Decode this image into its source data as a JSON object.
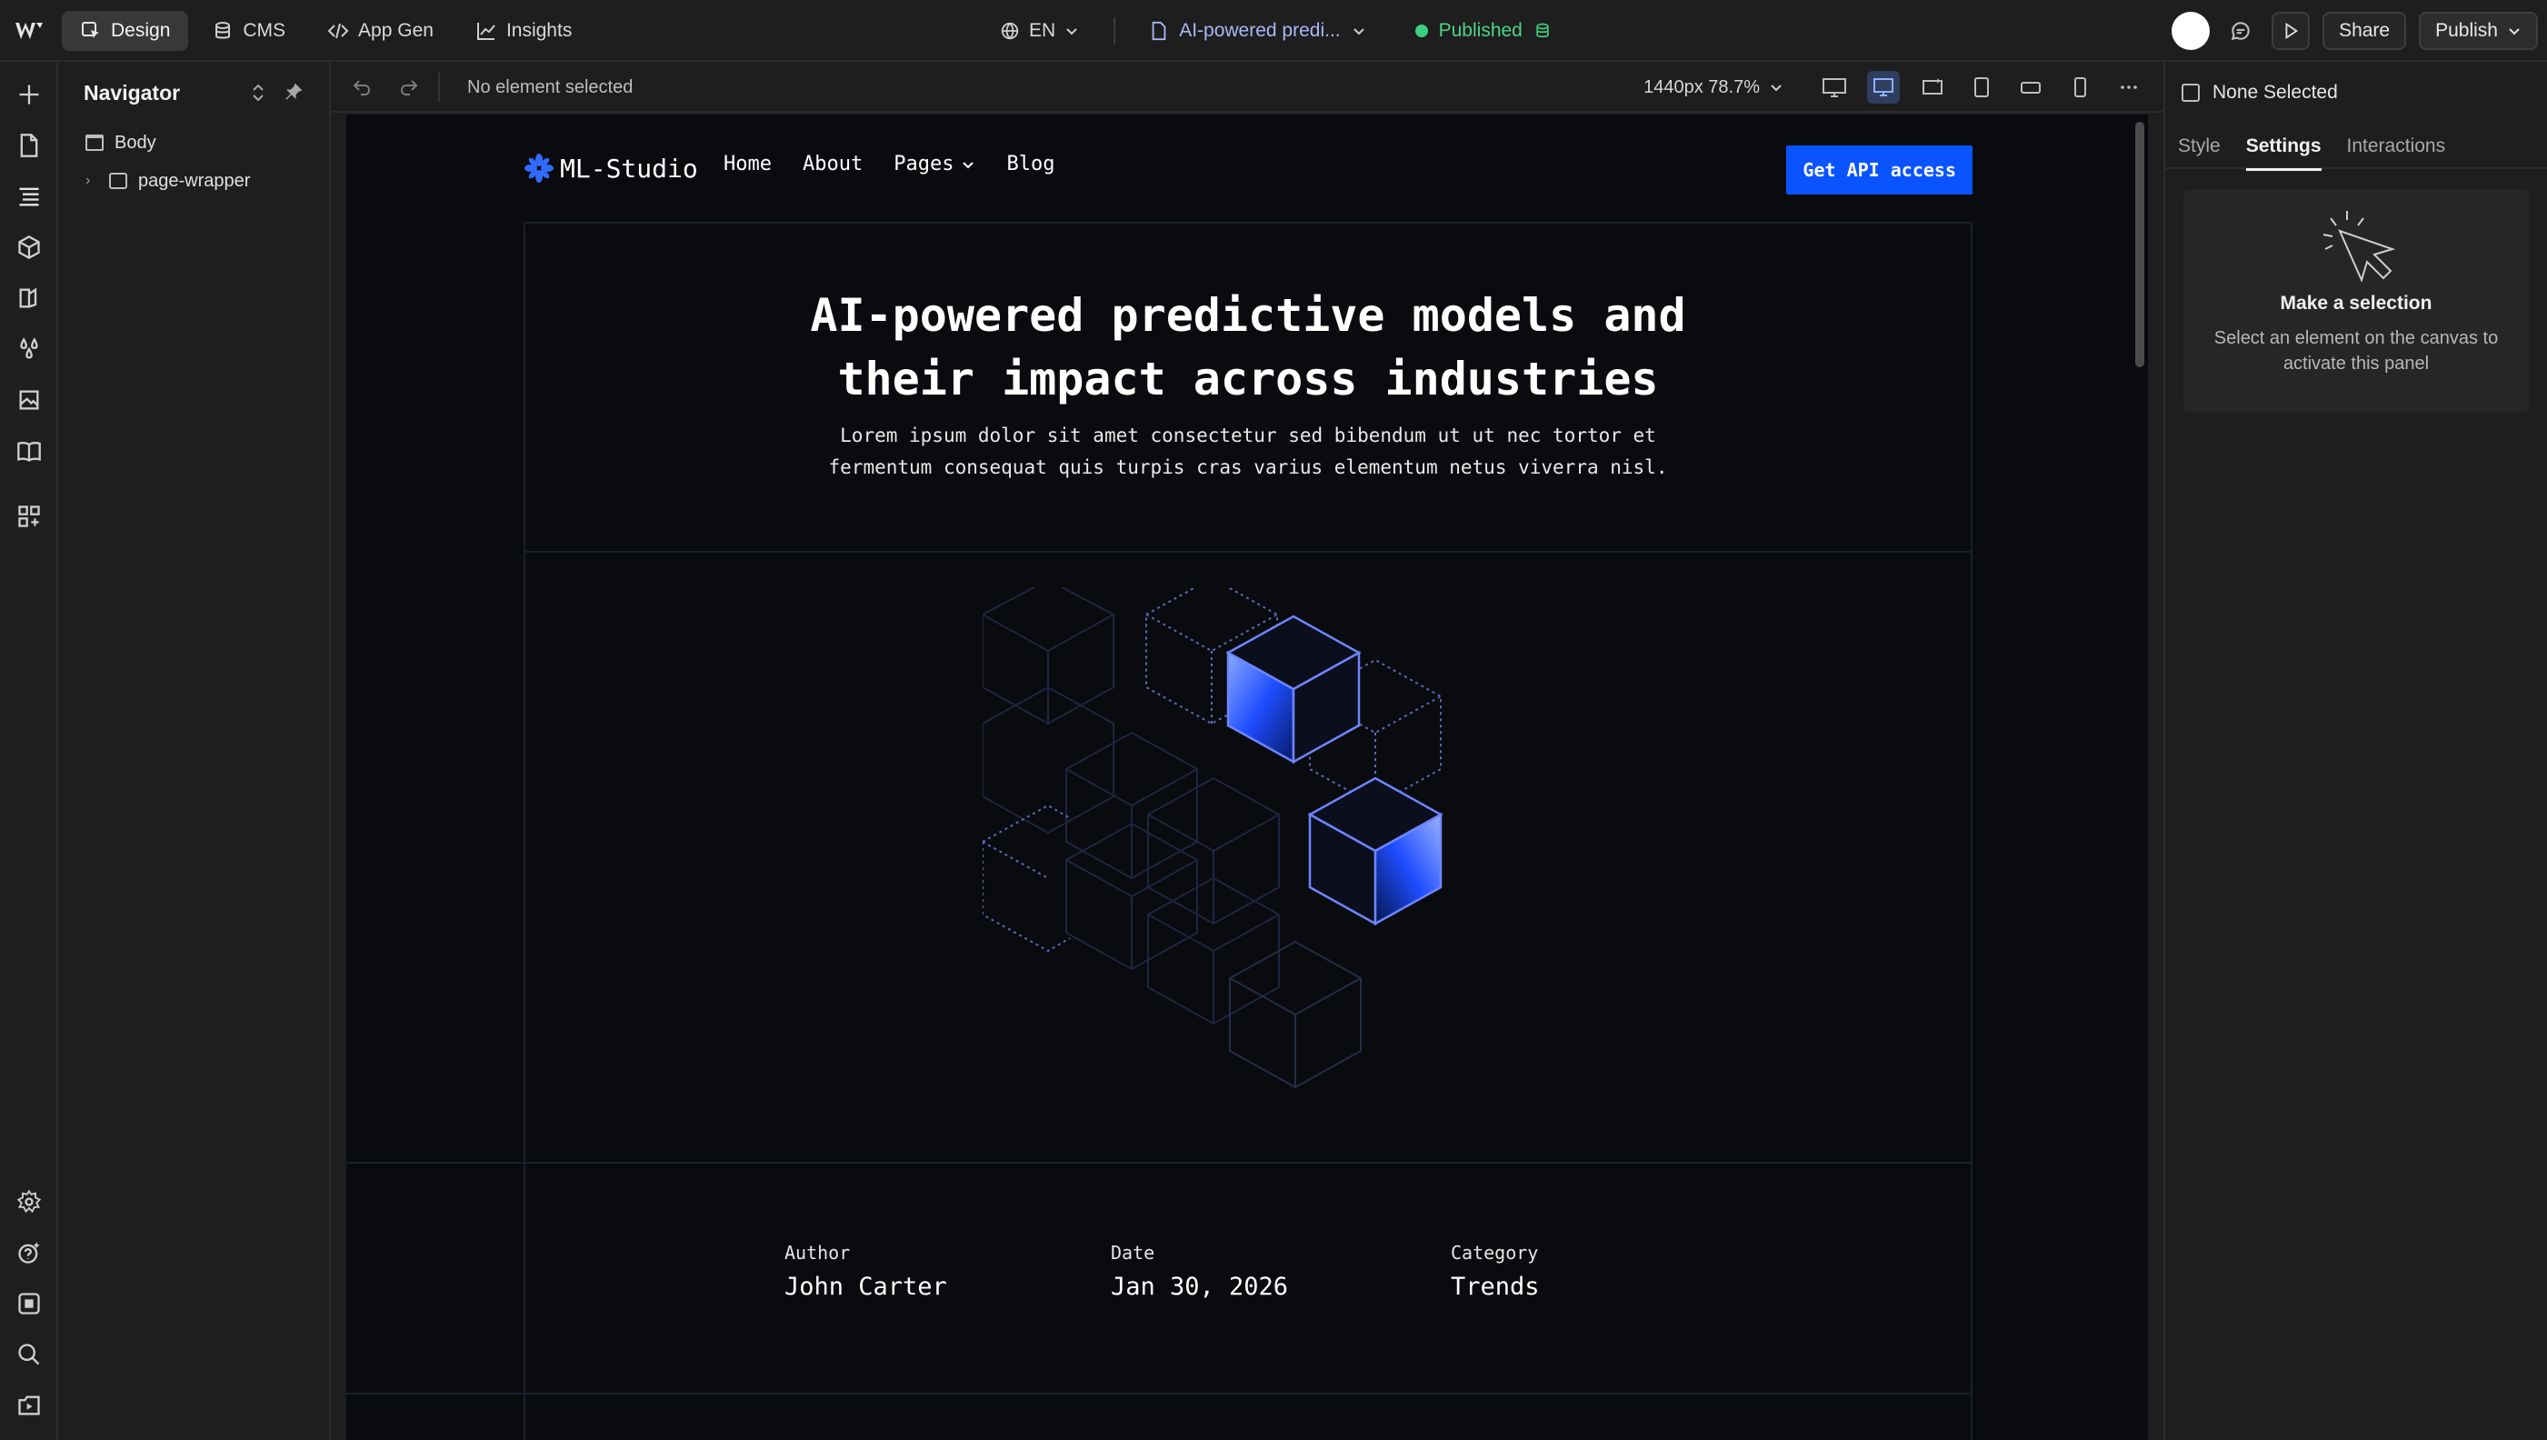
{
  "topbar": {
    "modes": [
      {
        "label": "Design",
        "icon": "cursor-square-icon",
        "active": true
      },
      {
        "label": "CMS",
        "icon": "database-icon",
        "active": false
      },
      {
        "label": "App Gen",
        "icon": "code-icon",
        "active": false
      },
      {
        "label": "Insights",
        "icon": "line-chart-icon",
        "active": false
      }
    ],
    "locale": "EN",
    "page_name": "AI-powered predi...",
    "publish_status": "Published",
    "share_label": "Share",
    "publish_label": "Publish",
    "status_color": "#3ccf7e"
  },
  "navigator": {
    "title": "Navigator",
    "tree": [
      {
        "label": "Body"
      },
      {
        "label": "page-wrapper"
      }
    ]
  },
  "canvas_toolbar": {
    "selection_status": "No element selected",
    "breakpoint": "1440px 78.7%"
  },
  "site": {
    "brand": "ML-Studio",
    "menu": [
      "Home",
      "About",
      "Pages",
      "Blog"
    ],
    "cta": "Get API access",
    "accent": "#0a54ff",
    "hero_title_line1": "AI-powered predictive models and",
    "hero_title_line2": "their impact across industries",
    "hero_sub_line1": "Lorem ipsum dolor sit amet consectetur sed bibendum ut ut nec tortor et",
    "hero_sub_line2": "fermentum consequat quis turpis cras varius elementum netus viverra nisl.",
    "meta": [
      {
        "label": "Author",
        "value": "John Carter"
      },
      {
        "label": "Date",
        "value": "Jan 30, 2026"
      },
      {
        "label": "Category",
        "value": "Trends"
      }
    ]
  },
  "right_panel": {
    "selection": "None Selected",
    "tabs": [
      "Style",
      "Settings",
      "Interactions"
    ],
    "active_tab": "Settings",
    "empty_title": "Make a selection",
    "empty_desc": "Select an element on the canvas to activate this panel"
  }
}
